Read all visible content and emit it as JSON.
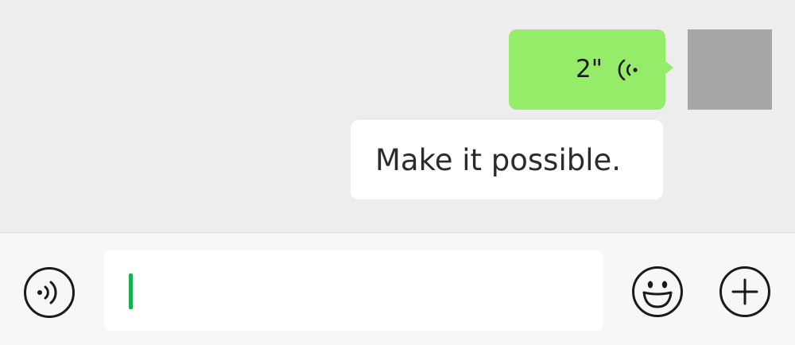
{
  "chat": {
    "voice_message": {
      "duration": "2\"",
      "icon": "voice-playback-icon"
    },
    "avatar": {
      "icon": "user-avatar-placeholder"
    },
    "text_message": {
      "text": "Make it possible."
    }
  },
  "input_bar": {
    "voice_toggle_icon": "voice-input-icon",
    "message_input_value": "",
    "emoji_icon": "emoji-smile-icon",
    "more_icon": "plus-circle-icon"
  },
  "colors": {
    "background": "#ededed",
    "outgoing_bubble": "#95ec69",
    "incoming_bubble": "#ffffff",
    "avatar_placeholder": "#a7a7a7",
    "caret": "#1aad50"
  }
}
